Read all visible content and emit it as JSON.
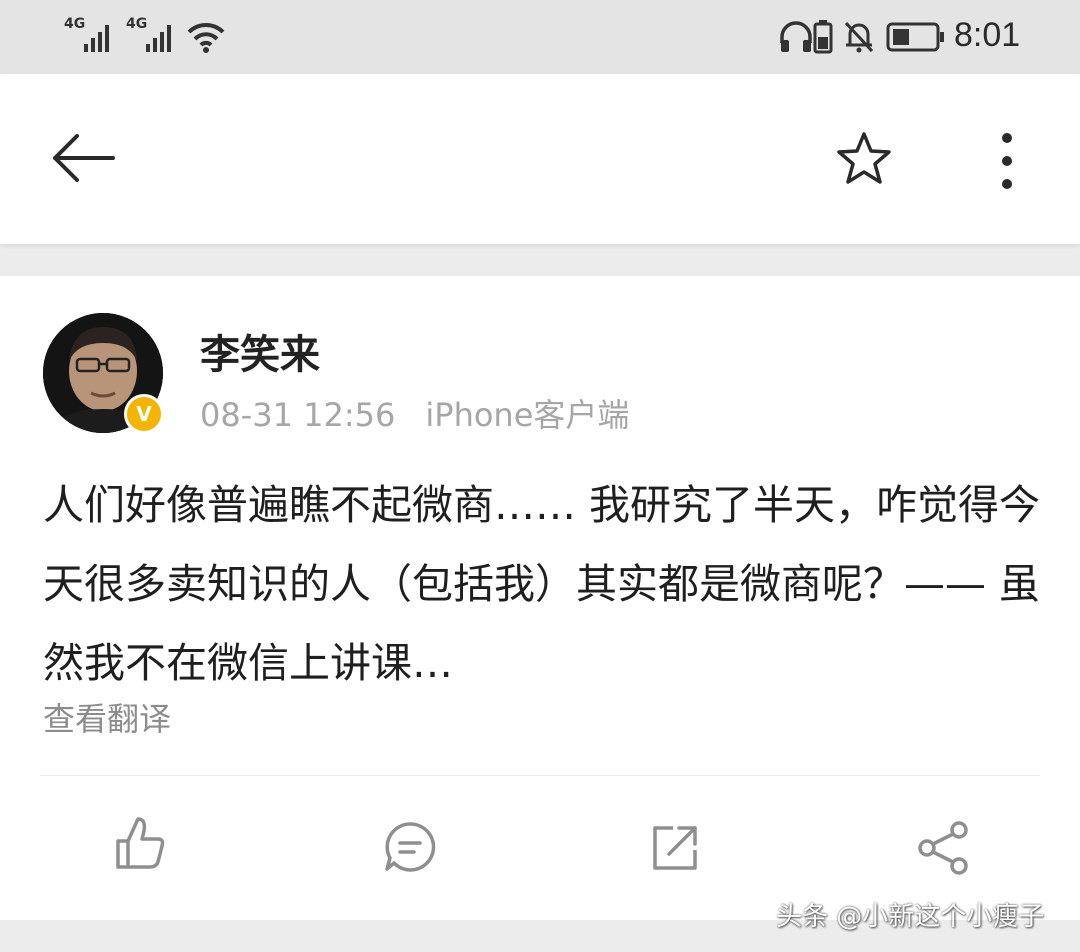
{
  "status_bar": {
    "signal_1_label": "4G",
    "signal_2_label": "4G",
    "time": "8:01",
    "icons": [
      "signal-icon",
      "signal-icon",
      "wifi-icon",
      "headphones-icon",
      "sim-battery-icon",
      "mute-icon",
      "battery-icon"
    ]
  },
  "app_bar": {
    "back_icon": "arrow-left-icon",
    "favorite_icon": "star-outline-icon",
    "more_icon": "more-vertical-icon"
  },
  "post": {
    "author": "李笑来",
    "verified_badge": "V",
    "date": "08-31 12:56",
    "source": "iPhone客户端",
    "text": "人们好像普遍瞧不起微商…… 我研究了半天，咋觉得今天很多卖知识的人（包括我）其实都是微商呢？—— 虽然我不在微信上讲课…",
    "translate_label": "查看翻译"
  },
  "actions": {
    "icons": [
      "thumbs-up-icon",
      "comment-icon",
      "repost-icon",
      "share-icon"
    ]
  },
  "watermark": "头条 @小新这个小瘦子",
  "colors": {
    "status_bar_bg": "#e4e4e4",
    "page_bg": "#ececec",
    "card_bg": "#ffffff",
    "verified": "#f5b400",
    "meta_text": "#a6a6a6"
  }
}
